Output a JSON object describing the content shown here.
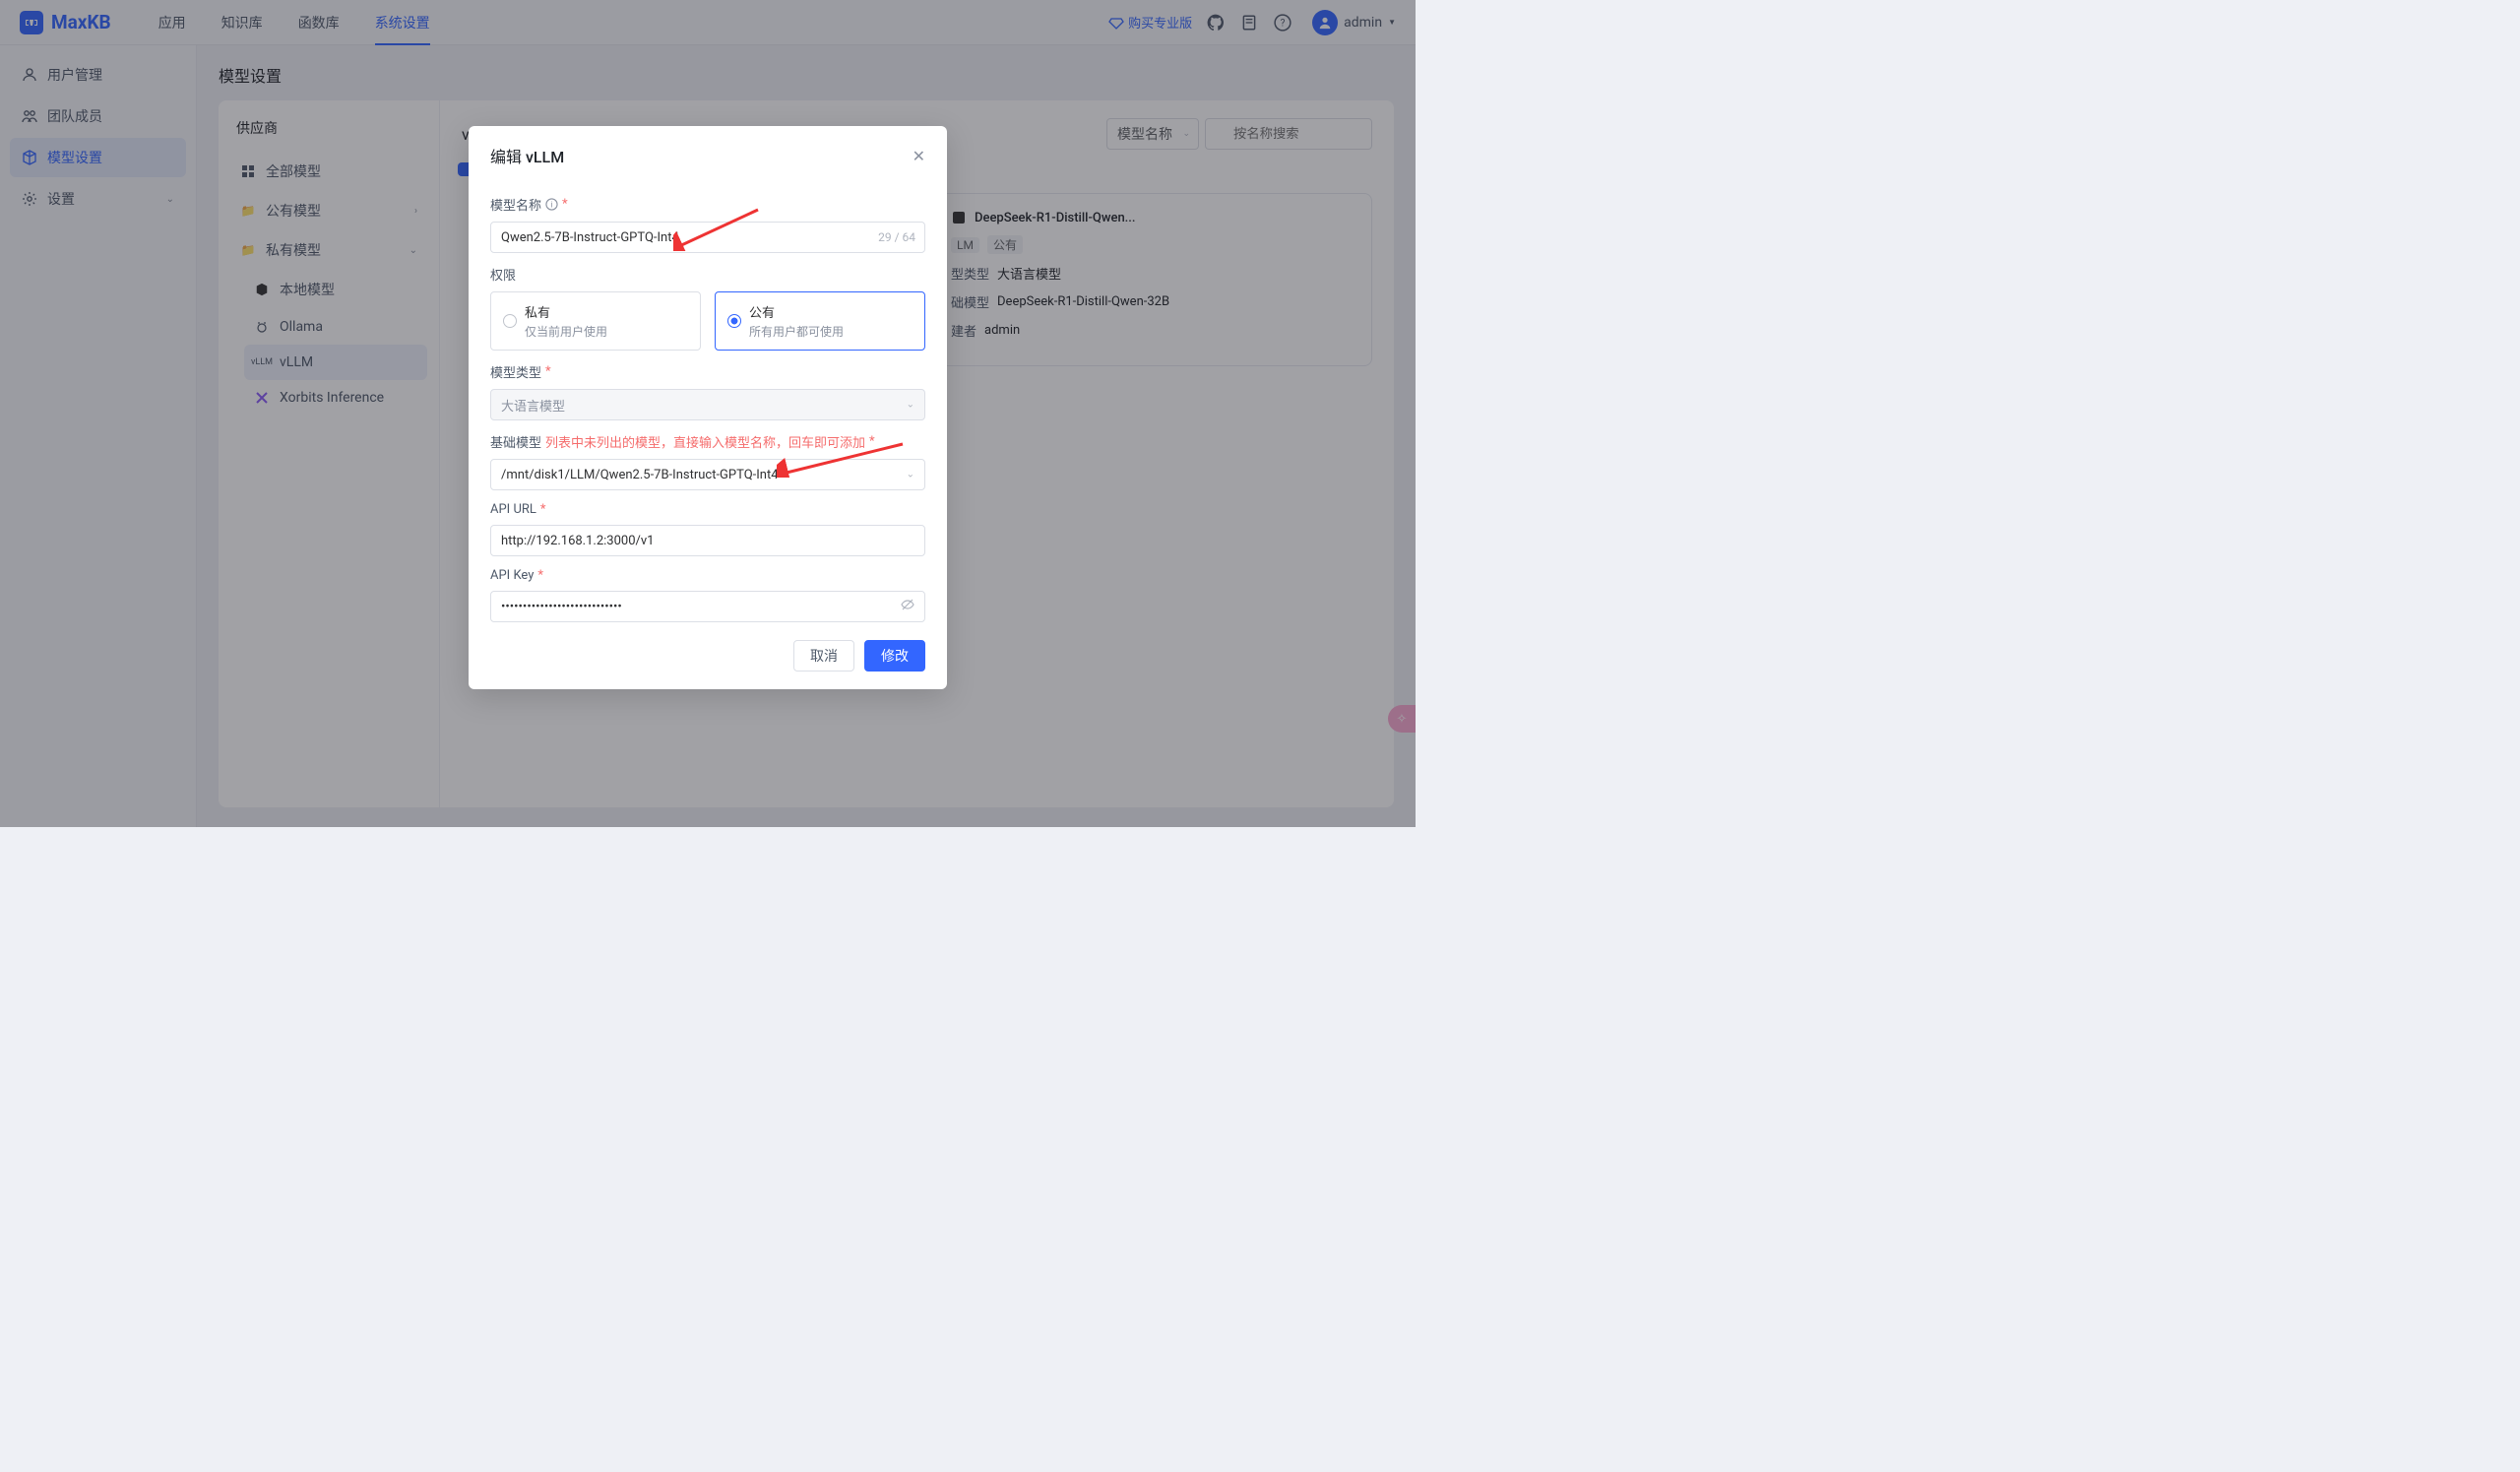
{
  "header": {
    "logo_text": "MaxKB",
    "tabs": [
      "应用",
      "知识库",
      "函数库",
      "系统设置"
    ],
    "active_tab": 3,
    "buy_pro": "购买专业版",
    "user_name": "admin"
  },
  "sidebar": {
    "items": [
      {
        "label": "用户管理",
        "icon": "user"
      },
      {
        "label": "团队成员",
        "icon": "team"
      },
      {
        "label": "模型设置",
        "icon": "cube",
        "active": true
      },
      {
        "label": "设置",
        "icon": "gear",
        "expandable": true
      }
    ]
  },
  "page": {
    "title": "模型设置"
  },
  "providers": {
    "title": "供应商",
    "all": "全部模型",
    "public": "公有模型",
    "private": "私有模型",
    "items": [
      {
        "label": "本地模型",
        "icon": "cube"
      },
      {
        "label": "Ollama",
        "icon": "ollama"
      },
      {
        "label": "vLLM",
        "icon": "vllm",
        "active": true
      },
      {
        "label": "Xorbits Inference",
        "icon": "xorbits"
      }
    ]
  },
  "model_list": {
    "title": "vLLM",
    "search_type": "模型名称",
    "search_placeholder": "按名称搜索",
    "card": {
      "name": "DeepSeek-R1-Distill-Qwen...",
      "tag_llm": "LM",
      "tag_scope": "公有",
      "type_label": "型类型",
      "type_value": "大语言模型",
      "base_label": "础模型",
      "base_value": "DeepSeek-R1-Distill-Qwen-32B",
      "creator_label": "建者",
      "creator_value": "admin"
    }
  },
  "modal": {
    "title": "编辑 vLLM",
    "name_label": "模型名称",
    "name_value": "Qwen2.5-7B-Instruct-GPTQ-Int4",
    "name_count": "29 / 64",
    "perm_label": "权限",
    "perm_private": "私有",
    "perm_private_desc": "仅当前用户使用",
    "perm_public": "公有",
    "perm_public_desc": "所有用户都可使用",
    "type_label": "模型类型",
    "type_value": "大语言模型",
    "base_label": "基础模型",
    "base_note": "列表中未列出的模型，直接输入模型名称，回车即可添加",
    "base_value": "/mnt/disk1/LLM/Qwen2.5-7B-Instruct-GPTQ-Int4",
    "api_url_label": "API URL",
    "api_url_value": "http://192.168.1.2:3000/v1",
    "api_key_label": "API Key",
    "api_key_value": "••••••••••••••••••••••••••••",
    "cancel": "取消",
    "submit": "修改"
  }
}
